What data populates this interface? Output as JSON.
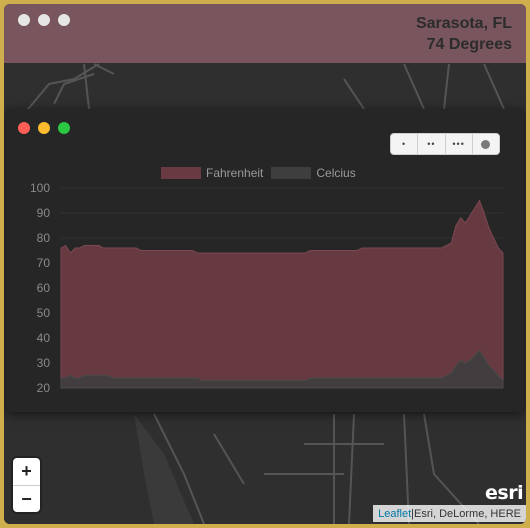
{
  "window": {
    "location": "Sarasota, FL",
    "temperature": "74 Degrees"
  },
  "chart_window": {
    "toolbar": {
      "btn1": "•",
      "btn2": "••",
      "btn3": "•••"
    }
  },
  "map": {
    "zoom_in": "+",
    "zoom_out": "−",
    "logo": "esri",
    "attribution_link": "Leaflet",
    "attribution_separator": " | ",
    "attribution_text": "Esri, DeLorme, HERE"
  },
  "chart_data": {
    "type": "area",
    "ylim": [
      20,
      100
    ],
    "yticks": [
      "100",
      "90",
      "80",
      "70",
      "60",
      "50",
      "40",
      "30",
      "20"
    ],
    "grid": true,
    "legend_position": "top",
    "series": [
      {
        "name": "Fahrenheit",
        "color": "#6a3a42",
        "values": [
          76,
          77,
          74,
          76,
          76,
          77,
          77,
          77,
          77,
          76,
          76,
          76,
          76,
          76,
          76,
          76,
          76,
          75,
          75,
          75,
          75,
          75,
          75,
          75,
          75,
          75,
          75,
          75,
          75,
          74,
          74,
          74,
          74,
          74,
          74,
          74,
          74,
          74,
          74,
          74,
          74,
          74,
          74,
          74,
          74,
          74,
          74,
          74,
          74,
          74,
          74,
          74,
          74,
          75,
          75,
          75,
          75,
          75,
          75,
          75,
          75,
          75,
          75,
          75,
          76,
          76,
          76,
          76,
          76,
          76,
          76,
          76,
          76,
          76,
          76,
          76,
          76,
          76,
          76,
          76,
          76,
          76,
          77,
          78,
          85,
          88,
          86,
          89,
          92,
          95,
          90,
          84,
          80,
          76,
          74
        ]
      },
      {
        "name": "Celcius",
        "color": "#3e3e3e",
        "values": [
          24,
          24,
          25,
          24,
          24,
          25,
          25,
          25,
          25,
          25,
          25,
          24,
          24,
          24,
          24,
          24,
          24,
          24,
          24,
          24,
          24,
          24,
          24,
          24,
          24,
          24,
          24,
          24,
          24,
          24,
          23,
          23,
          23,
          23,
          23,
          23,
          23,
          23,
          23,
          23,
          23,
          23,
          23,
          23,
          23,
          23,
          23,
          23,
          23,
          23,
          23,
          23,
          23,
          24,
          24,
          24,
          24,
          24,
          24,
          24,
          24,
          24,
          24,
          24,
          24,
          24,
          24,
          24,
          24,
          24,
          24,
          24,
          24,
          24,
          24,
          24,
          24,
          24,
          24,
          24,
          24,
          24,
          25,
          26,
          29,
          31,
          30,
          31,
          33,
          35,
          32,
          29,
          27,
          25,
          23
        ]
      }
    ]
  }
}
